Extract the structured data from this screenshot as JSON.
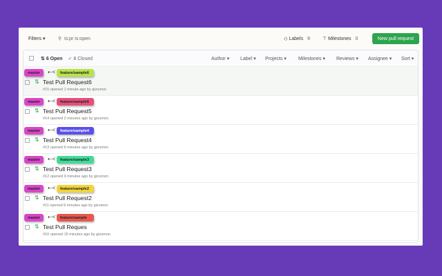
{
  "toolbar": {
    "filters": "Filters ▾",
    "search_value": "is:pr is:open",
    "labels": "Labels",
    "labels_count": "9",
    "milestones": "Milestones",
    "milestones_count": "0",
    "new_pr": "New pull request"
  },
  "list_header": {
    "open": "6 Open",
    "closed": "✓ 8 Closed",
    "filters": [
      "Author ▾",
      "Label ▾",
      "Projects ▾",
      "Milestones ▾",
      "Reviews ▾",
      "Assignee ▾",
      "Sort ▾"
    ]
  },
  "prs": [
    {
      "base": "master",
      "head": "feature/sample6",
      "head_color": "#b8e34a",
      "head_text": "#222",
      "title": "Test Pull Request6",
      "meta": "#15 opened 1 minute ago by gizumon"
    },
    {
      "base": "master",
      "head": "feature/sample5",
      "head_color": "#e6507c",
      "head_text": "#222",
      "title": "Test Pull Request5",
      "meta": "#14 opened 2 minutes ago by gizumon"
    },
    {
      "base": "master",
      "head": "feature/sample4",
      "head_color": "#5a50e8",
      "head_text": "#fff",
      "title": "Test Pull Request4",
      "meta": "#13 opened 6 minutes ago by gizumon"
    },
    {
      "base": "master",
      "head": "feature/sample3",
      "head_color": "#3fdc98",
      "head_text": "#222",
      "title": "Test Pull Request3",
      "meta": "#12 opened 9 minutes ago by gizumon"
    },
    {
      "base": "master",
      "head": "feature/sample2",
      "head_color": "#f0d43c",
      "head_text": "#222",
      "title": "Test Pull Request2",
      "meta": "#11 opened 9 minutes ago by gizumon"
    },
    {
      "base": "master",
      "head": "feature/sample",
      "head_color": "#e8584f",
      "head_text": "#222",
      "title": "Test Pull Reques",
      "meta": "#10 opened 15 minutes ago by gizumon"
    }
  ]
}
